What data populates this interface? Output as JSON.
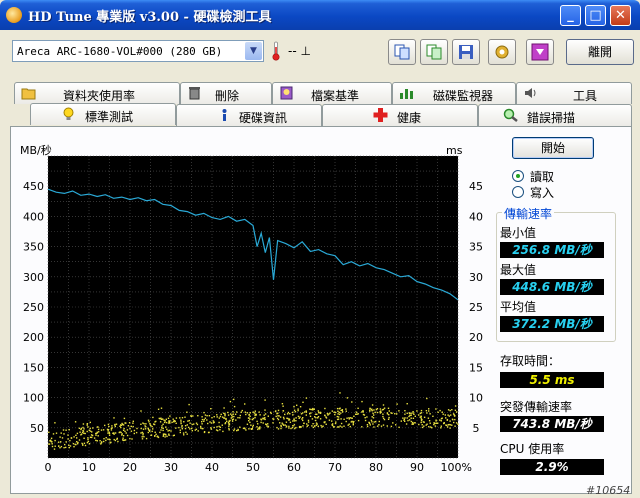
{
  "window": {
    "title": "HD Tune 專業版 v3.00 - 硬碟檢測工具",
    "minimize_glyph": "_",
    "maximize_glyph": "□",
    "close_glyph": "✕"
  },
  "toolbar": {
    "drive": "Areca   ARC-1680-VOL#000 (280 GB)",
    "temperature": "-- ⊥",
    "buttons": [
      "copy-info-icon",
      "copy-screenshot-icon",
      "save-icon",
      "options-icon",
      "download-icon"
    ],
    "exit_label": "離開"
  },
  "tabs_row1": [
    "資料夾使用率",
    "刪除",
    "檔案基準",
    "磁碟監視器",
    "工具"
  ],
  "tabs_row2": [
    "標準測試",
    "硬碟資訊",
    "健康",
    "錯誤掃描"
  ],
  "active_tab": "標準測試",
  "controls": {
    "start_label": "開始",
    "read_label": "讀取",
    "write_label": "寫入",
    "selected_mode": "read"
  },
  "stats": {
    "transfer_title": "傳輸速率",
    "min_label": "最小值",
    "min_value": "256.8 MB/秒",
    "max_label": "最大值",
    "max_value": "448.6 MB/秒",
    "avg_label": "平均值",
    "avg_value": "372.2 MB/秒",
    "access_label": "存取時間：",
    "access_value": "5.5 ms",
    "burst_label": "突發傳輸速率",
    "burst_value": "743.8 MB/秒",
    "cpu_label": "CPU 使用率",
    "cpu_value": "2.9%"
  },
  "watermark": "#10654",
  "colors": {
    "chart_bg": "#000000",
    "grid": "#555555",
    "transfer_line": "#2aa9d6",
    "access_dots": "#e8e040"
  },
  "chart_data": {
    "type": "line",
    "y_label_left": "MB/秒",
    "y_label_right": "ms",
    "y_left_range": [
      0,
      500
    ],
    "y_right_range": [
      0,
      50
    ],
    "x_range": [
      0,
      100
    ],
    "y_ticks_left": [
      "50",
      "100",
      "150",
      "200",
      "250",
      "300",
      "350",
      "400",
      "450"
    ],
    "y_ticks_right": [
      "5",
      "10",
      "15",
      "20",
      "25",
      "30",
      "35",
      "40",
      "45"
    ],
    "x_ticks": [
      "0",
      "10",
      "20",
      "30",
      "40",
      "50",
      "60",
      "70",
      "80",
      "90",
      "100%"
    ],
    "series": [
      {
        "x": [
          0,
          2,
          4,
          6,
          8,
          10,
          12,
          14,
          16,
          18,
          20,
          22,
          24,
          26,
          28,
          30,
          32,
          34,
          36,
          38,
          40,
          42,
          44,
          46,
          48,
          50,
          51,
          52,
          53,
          54,
          55,
          56,
          58,
          60,
          62,
          64,
          66,
          68,
          70,
          72,
          74,
          76,
          78,
          80,
          82,
          84,
          86,
          88,
          90,
          92,
          94,
          96,
          98,
          100
        ],
        "y": [
          445,
          440,
          438,
          442,
          435,
          437,
          433,
          436,
          430,
          432,
          428,
          431,
          426,
          428,
          420,
          418,
          410,
          408,
          402,
          405,
          398,
          395,
          400,
          392,
          395,
          385,
          350,
          372,
          340,
          365,
          295,
          360,
          355,
          348,
          358,
          342,
          345,
          338,
          335,
          320,
          325,
          318,
          322,
          315,
          312,
          306,
          300,
          302,
          292,
          288,
          282,
          278,
          272,
          262
        ]
      },
      {
        "x": [
          0,
          5,
          10,
          15,
          20,
          25,
          30,
          35,
          40,
          45,
          50,
          55,
          60,
          65,
          70,
          75,
          80,
          85,
          90,
          95,
          100
        ],
        "y": [
          3.0,
          3.4,
          3.8,
          4.2,
          4.6,
          5.0,
          5.3,
          5.6,
          5.9,
          6.2,
          6.4,
          6.5,
          6.6,
          6.7,
          6.8,
          6.8,
          6.8,
          6.8,
          6.8,
          6.7,
          6.6
        ]
      }
    ]
  }
}
